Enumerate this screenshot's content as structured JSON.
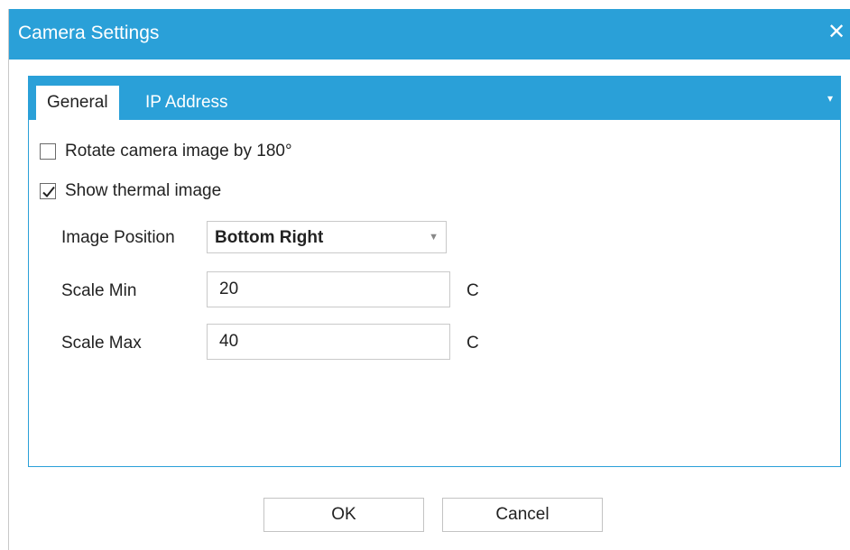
{
  "dialog": {
    "title": "Camera Settings",
    "close_glyph": "✕"
  },
  "tabs": [
    {
      "label": "General",
      "active": true
    },
    {
      "label": "IP Address",
      "active": false
    }
  ],
  "tab_menu_glyph": "▾",
  "general": {
    "rotate_label": "Rotate camera image by 180°",
    "rotate_checked": false,
    "thermal_label": "Show thermal image",
    "thermal_checked": true,
    "image_position_label": "Image Position",
    "image_position_value": "Bottom Right",
    "scale_min_label": "Scale Min",
    "scale_min_value": "20",
    "scale_min_unit": "C",
    "scale_max_label": "Scale Max",
    "scale_max_value": "40",
    "scale_max_unit": "C"
  },
  "buttons": {
    "ok": "OK",
    "cancel": "Cancel"
  },
  "colors": {
    "accent": "#2aa0d8"
  }
}
